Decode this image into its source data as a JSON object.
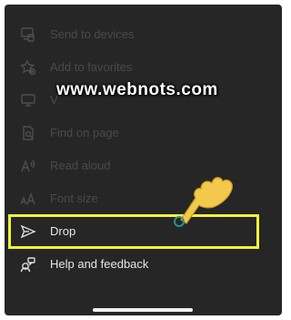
{
  "menu": {
    "items": [
      {
        "label": "Send to devices",
        "icon": "send-to-devices-icon"
      },
      {
        "label": "Add to favorites",
        "icon": "add-favorite-icon"
      },
      {
        "label": "V",
        "icon": "view-desktop-icon"
      },
      {
        "label": "Find on page",
        "icon": "find-on-page-icon"
      },
      {
        "label": "Read aloud",
        "icon": "read-aloud-icon"
      },
      {
        "label": "Font size",
        "icon": "font-size-icon"
      },
      {
        "label": "Drop",
        "icon": "drop-send-icon"
      },
      {
        "label": "Help and feedback",
        "icon": "help-feedback-icon"
      }
    ]
  },
  "watermark": {
    "text": "www.webnots.com"
  },
  "colors": {
    "highlight": "#f2f23a",
    "panel": "#262626",
    "pointer": "#f2c94c"
  }
}
